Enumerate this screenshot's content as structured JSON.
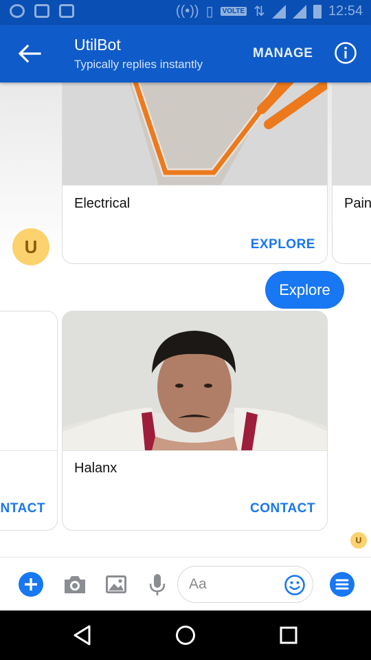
{
  "status_bar": {
    "time": "12:54",
    "volte": "VOLTE"
  },
  "header": {
    "title": "UtilBot",
    "subtitle": "Typically replies instantly",
    "manage_label": "MANAGE"
  },
  "chat": {
    "bot_avatar_letter": "U",
    "cards_top": [
      {
        "title": "Electrical",
        "button": "EXPLORE"
      },
      {
        "title": "Pain"
      }
    ],
    "user_message": "Explore",
    "cards_bottom": [
      {
        "button": "NTACT"
      },
      {
        "title": "Halanx",
        "button": "CONTACT"
      }
    ],
    "read_receipt_letter": "U"
  },
  "composer": {
    "placeholder": "Aa"
  },
  "colors": {
    "header_bg": "#0f5bc9",
    "status_bg": "#0a4fb3",
    "accent": "#1877f2",
    "bot_avatar": "#fbd26e",
    "plug_orange": "#ec7a1c"
  },
  "icons": {
    "back": "arrow-left-icon",
    "info": "info-icon",
    "add": "plus-circle-icon",
    "camera": "camera-icon",
    "gallery": "image-icon",
    "mic": "microphone-icon",
    "emoji": "smiley-icon",
    "menu": "menu-circle-icon",
    "nav_back": "triangle-back-icon",
    "nav_home": "circle-home-icon",
    "nav_recents": "square-recents-icon"
  }
}
